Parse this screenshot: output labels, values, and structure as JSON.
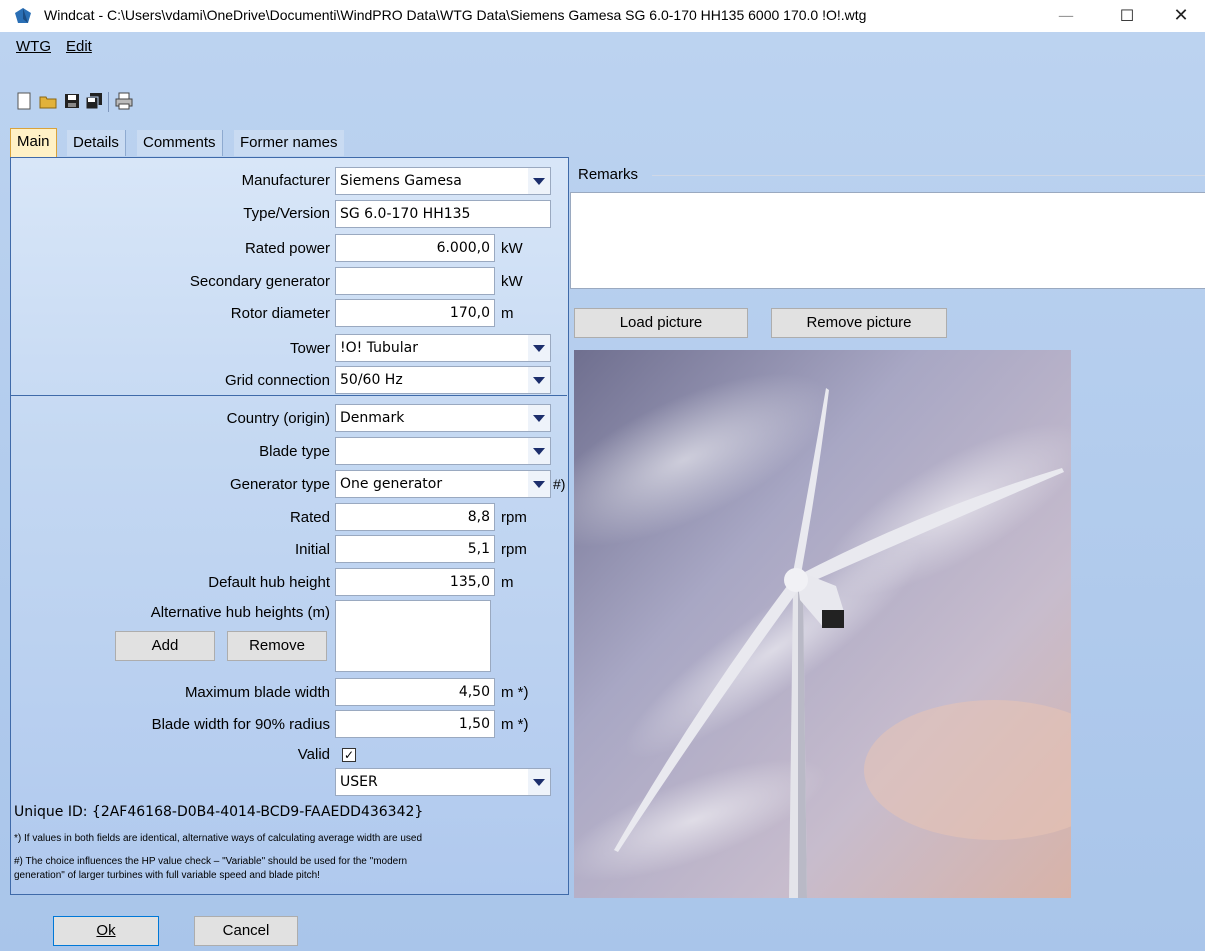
{
  "window": {
    "title": "Windcat - C:\\Users\\vdami\\OneDrive\\Documenti\\WindPRO Data\\WTG Data\\Siemens Gamesa SG 6.0-170 HH135 6000 170.0 !O!.wtg",
    "minimize": "—",
    "maximize": "☐",
    "close": "✕"
  },
  "menu": {
    "wtg": "WTG",
    "edit": "Edit"
  },
  "tabs": [
    "Main",
    "Details",
    "Comments",
    "Former names"
  ],
  "form": {
    "manufacturer": {
      "label": "Manufacturer",
      "value": "Siemens Gamesa"
    },
    "type_version": {
      "label": "Type/Version",
      "value": "SG 6.0-170 HH135"
    },
    "rated_power": {
      "label": "Rated power",
      "value": "6.000,0",
      "unit": "kW"
    },
    "secondary_generator": {
      "label": "Secondary generator",
      "value": "",
      "unit": "kW"
    },
    "rotor_diameter": {
      "label": "Rotor diameter",
      "value": "170,0",
      "unit": "m"
    },
    "tower": {
      "label": "Tower",
      "value": "!O! Tubular"
    },
    "grid_connection": {
      "label": "Grid connection",
      "value": "50/60 Hz"
    },
    "country": {
      "label": "Country (origin)",
      "value": "Denmark"
    },
    "blade_type": {
      "label": "Blade type",
      "value": ""
    },
    "generator_type": {
      "label": "Generator type",
      "value": "One generator",
      "note_mark": "#)"
    },
    "rated_rpm": {
      "label": "Rated",
      "value": "8,8",
      "unit": "rpm"
    },
    "initial_rpm": {
      "label": "Initial",
      "value": "5,1",
      "unit": "rpm"
    },
    "default_hub_height": {
      "label": "Default hub height",
      "value": "135,0",
      "unit": "m"
    },
    "alt_hub_heights": {
      "label": "Alternative hub heights (m)",
      "add": "Add",
      "remove": "Remove"
    },
    "max_blade_width": {
      "label": "Maximum blade width",
      "value": "4,50",
      "unit": "m *)"
    },
    "blade_width_90": {
      "label": "Blade width for 90% radius",
      "value": "1,50",
      "unit": "m *)"
    },
    "valid": {
      "label": "Valid",
      "checked": "✓"
    },
    "user_combo": {
      "value": "USER"
    }
  },
  "unique_id": "Unique ID: {2AF46168-D0B4-4014-BCD9-FAAEDD436342}",
  "notes": [
    "*) If values in both fields are identical, alternative ways of calculating average width are used",
    "#) The choice influences the HP value check – \"Variable\" should be used for the \"modern",
    "generation\" of larger turbines with full variable speed and blade pitch!"
  ],
  "remarks": {
    "label": "Remarks",
    "value": ""
  },
  "picture": {
    "load": "Load picture",
    "remove": "Remove picture"
  },
  "dialog": {
    "ok": "Ok",
    "cancel": "Cancel"
  },
  "colors": {
    "panel_border": "#3f6aa9",
    "tab_active": "#fff1c6",
    "combo_arrow": "#1c2e6c",
    "sky": "#a9a2bd"
  }
}
